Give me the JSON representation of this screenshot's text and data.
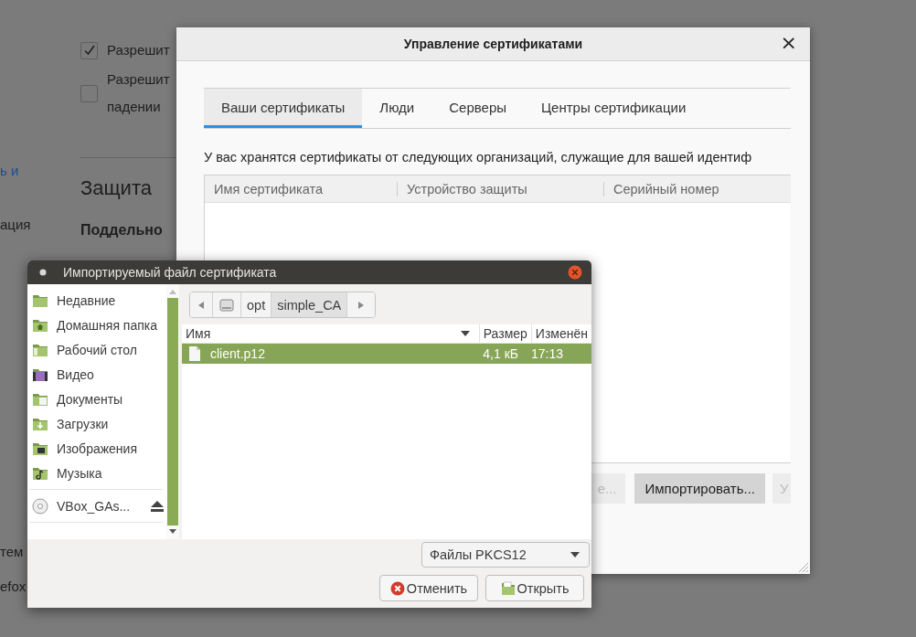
{
  "background_page": {
    "left_fragments": [
      {
        "text": "ь и",
        "kind": "link"
      },
      {
        "text": "ация",
        "kind": "text"
      },
      {
        "text": "тем",
        "kind": "text"
      },
      {
        "text": "efox",
        "kind": "text"
      }
    ],
    "checkboxes": [
      {
        "lines": [
          "Разрешит"
        ],
        "checked": true
      },
      {
        "lines": [
          "Разрешит",
          "падении"
        ],
        "checked": false
      }
    ],
    "heading": "Защита",
    "subheading": "Поддельно"
  },
  "certificate_manager": {
    "title": "Управление сертификатами",
    "close": "×",
    "tabs": [
      {
        "label": "Ваши сертификаты",
        "selected": true
      },
      {
        "label": "Люди",
        "selected": false
      },
      {
        "label": "Серверы",
        "selected": false
      },
      {
        "label": "Центры сертификации",
        "selected": false
      }
    ],
    "description": "У вас хранятся сертификаты от следующих организаций, служащие для вашей идентиф",
    "table": {
      "columns": [
        "Имя сертификата",
        "Устройство защиты",
        "Серийный номер"
      ]
    },
    "buttons": [
      {
        "label": "е...",
        "hovered": false
      },
      {
        "label": "Импортировать...",
        "hovered": true
      },
      {
        "label": "У",
        "hovered": false
      }
    ]
  },
  "file_dialog": {
    "title": "Импортируемый файл сертификата",
    "places": [
      {
        "label": "Недавние",
        "kind": "recent"
      },
      {
        "label": "Домашняя папка",
        "kind": "home"
      },
      {
        "label": "Рабочий стол",
        "kind": "desktop"
      },
      {
        "label": "Видео",
        "kind": "video"
      },
      {
        "label": "Документы",
        "kind": "documents"
      },
      {
        "label": "Загрузки",
        "kind": "downloads"
      },
      {
        "label": "Изображения",
        "kind": "pictures"
      },
      {
        "label": "Музыка",
        "kind": "music"
      }
    ],
    "devices": [
      {
        "label": "VBox_GAs...",
        "ejectable": true
      }
    ],
    "path": [
      {
        "kind": "disk",
        "selected": false
      },
      {
        "label": "opt",
        "kind": "folder",
        "selected": false
      },
      {
        "label": "simple_CA",
        "kind": "folder",
        "selected": true
      }
    ],
    "columns": [
      {
        "label": "Имя",
        "sorted": true
      },
      {
        "label": "Размер",
        "sorted": false
      },
      {
        "label": "Изменён",
        "sorted": false
      }
    ],
    "files": [
      {
        "name": "client.p12",
        "size": "4,1 кБ",
        "modified": "17:13",
        "selected": true
      }
    ],
    "filter": "Файлы PKCS12",
    "buttons": [
      {
        "label": "Отменить",
        "kind": "cancel"
      },
      {
        "label": "Открыть",
        "kind": "open"
      }
    ]
  }
}
